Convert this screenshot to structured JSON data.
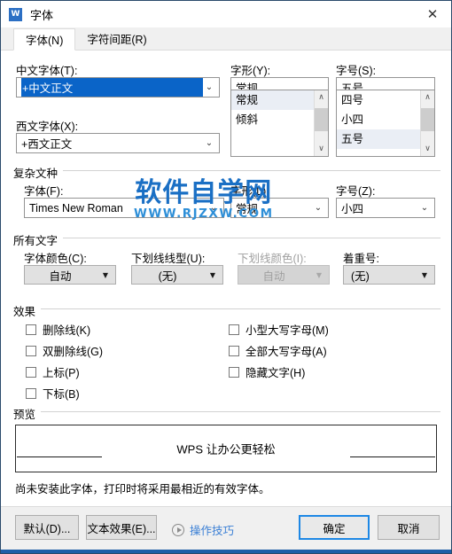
{
  "window": {
    "title": "字体",
    "app_icon": "wps-icon",
    "close_label": "✕",
    "accent_color": "#1e5fa8"
  },
  "tabs": [
    {
      "label": "字体(N)",
      "active": true
    },
    {
      "label": "字符间距(R)",
      "active": false
    }
  ],
  "chinese_section": {
    "chinese_font_label": "中文字体(T):",
    "chinese_font_value": "+中文正文",
    "western_font_label": "西文字体(X):",
    "western_font_value": "+西文正文",
    "style_label": "字形(Y):",
    "style_value": "常规",
    "style_options": [
      {
        "label": "常规",
        "selected": true
      },
      {
        "label": "倾斜",
        "selected": false
      },
      {
        "label": "",
        "selected": false
      }
    ],
    "size_label": "字号(S):",
    "size_value": "五号",
    "size_options": [
      {
        "label": "四号",
        "selected": false
      },
      {
        "label": "小四",
        "selected": false
      },
      {
        "label": "五号",
        "selected": true
      }
    ]
  },
  "complex_section": {
    "title": "复杂文种",
    "font_label": "字体(F):",
    "font_value": "Times New Roman",
    "style_label": "字形(L):",
    "style_value": "常规",
    "size_label": "字号(Z):",
    "size_value": "小四"
  },
  "all_text_section": {
    "title": "所有文字",
    "font_color_label": "字体颜色(C):",
    "font_color_value": "自动",
    "underline_style_label": "下划线线型(U):",
    "underline_style_value": "(无)",
    "underline_color_label": "下划线颜色(I):",
    "underline_color_value": "自动",
    "underline_color_disabled": true,
    "emphasis_label": "着重号:",
    "emphasis_value": "(无)"
  },
  "effects_section": {
    "title": "效果",
    "left_column": [
      {
        "label": "删除线(K)",
        "checked": false
      },
      {
        "label": "双删除线(G)",
        "checked": false
      },
      {
        "label": "上标(P)",
        "checked": false
      },
      {
        "label": "下标(B)",
        "checked": false
      }
    ],
    "right_column": [
      {
        "label": "小型大写字母(M)",
        "checked": false
      },
      {
        "label": "全部大写字母(A)",
        "checked": false
      },
      {
        "label": "隐藏文字(H)",
        "checked": false
      }
    ]
  },
  "preview_section": {
    "title": "预览",
    "sample_text": "WPS 让办公更轻松",
    "note": "尚未安装此字体，打印时将采用最相近的有效字体。"
  },
  "footer": {
    "default_button": "默认(D)...",
    "text_effects_button": "文本效果(E)...",
    "tips_link": "操作技巧",
    "tips_icon": "play-circle-icon",
    "ok_button": "确定",
    "cancel_button": "取消"
  },
  "watermark": {
    "main": "软件自学网",
    "sub": "WWW.RJZXW.COM"
  }
}
